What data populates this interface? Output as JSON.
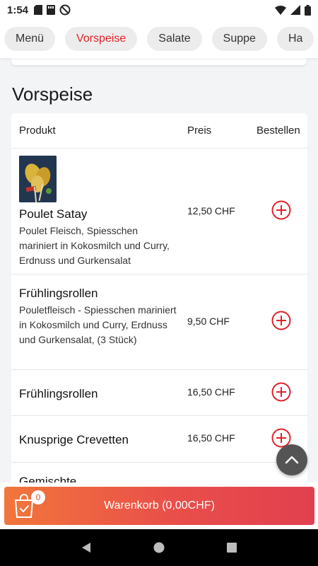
{
  "status": {
    "time": "1:54",
    "icons": [
      "sim-card-icon",
      "storage-icon",
      "no-sync-icon",
      "wifi-icon",
      "signal-icon",
      "battery-icon"
    ]
  },
  "categories": {
    "items": [
      "Menü",
      "Vorspeise",
      "Salate",
      "Suppe",
      "Ha"
    ],
    "active": "Vorspeise"
  },
  "section": {
    "title": "Vorspeise"
  },
  "table": {
    "headers": {
      "product": "Produkt",
      "price": "Preis",
      "order": "Bestellen"
    },
    "rows": [
      {
        "name": "Poulet Satay",
        "desc": "Poulet Fleisch, Spiesschen mariniert in Kokosmilch und Curry, Erdnuss und Gurkensalat",
        "price": "12,50 CHF",
        "has_image": true
      },
      {
        "name": "Frühlingsrollen",
        "desc": "Pouletfleisch - Spiesschen mariniert in Kokosmilch und Curry, Erdnuss und Gurkensalat, (3 Stück)",
        "price": "9,50 CHF"
      },
      {
        "name": "Frühlingsrollen",
        "desc": "",
        "price": "16,50 CHF"
      },
      {
        "name": "Knusprige Crevetten",
        "desc": "",
        "price": "16,50 CHF"
      },
      {
        "name": "Gemischte",
        "desc": "",
        "price": ""
      }
    ]
  },
  "cart": {
    "label": "Warenkorb (0,00CHF)",
    "count": "0"
  },
  "colors": {
    "accent": "#e0222a",
    "cart_start": "#f2763b",
    "cart_end": "#e1404f"
  }
}
